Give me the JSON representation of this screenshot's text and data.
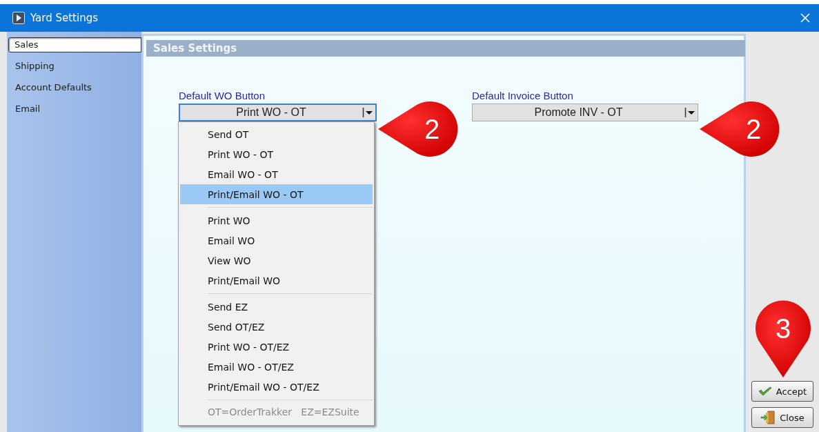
{
  "window": {
    "title": "Yard Settings"
  },
  "sidebar": {
    "items": [
      {
        "label": "Sales",
        "selected": true
      },
      {
        "label": "Shipping",
        "selected": false
      },
      {
        "label": "Account Defaults",
        "selected": false
      },
      {
        "label": "Email",
        "selected": false
      }
    ]
  },
  "panel": {
    "title": "Sales Settings"
  },
  "fields": [
    {
      "label": "Default WO Button",
      "value": "Print WO - OT",
      "expanded": true,
      "callout": "2",
      "menu": {
        "groups": [
          [
            {
              "label": "Send  OT",
              "selected": false
            },
            {
              "label": "Print WO - OT",
              "selected": false
            },
            {
              "label": "Email WO - OT",
              "selected": false
            },
            {
              "label": "Print/Email WO - OT",
              "selected": true
            }
          ],
          [
            {
              "label": "Print WO",
              "selected": false
            },
            {
              "label": "Email WO",
              "selected": false
            },
            {
              "label": "View WO",
              "selected": false
            },
            {
              "label": "Print/Email WO",
              "selected": false
            }
          ],
          [
            {
              "label": "Send EZ",
              "selected": false
            },
            {
              "label": "Send OT/EZ",
              "selected": false
            },
            {
              "label": "Print WO - OT/EZ",
              "selected": false
            },
            {
              "label": "Email WO - OT/EZ",
              "selected": false
            },
            {
              "label": "Print/Email WO - OT/EZ",
              "selected": false
            }
          ]
        ],
        "note": "OT=OrderTrakker   EZ=EZSuite"
      }
    },
    {
      "label": "Default Invoice Button",
      "value": "Promote INV - OT",
      "expanded": false,
      "callout": "2"
    }
  ],
  "buttons": [
    {
      "label": "Accept",
      "kind": "accept",
      "callout": "3"
    },
    {
      "label": "Close",
      "kind": "close"
    }
  ]
}
